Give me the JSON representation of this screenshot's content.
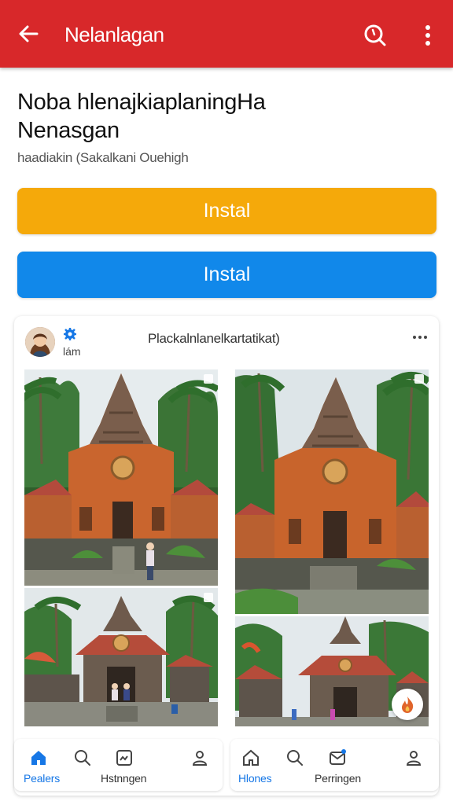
{
  "appbar": {
    "title": "Nelanlagan",
    "icons": [
      "arrow-left-icon",
      "search-icon",
      "more-vert-icon"
    ],
    "color": "#d8282a"
  },
  "headline": {
    "line1": "Noba hlenajkiaplaningHa",
    "line2": "Nenasgan"
  },
  "subline": "haadiakin (Sakalkani Ouehigh",
  "buttons": [
    {
      "label": "Instal",
      "color": "#f5a90a"
    },
    {
      "label": "Instal",
      "color": "#1188ea"
    }
  ],
  "post": {
    "author_meta": "lám",
    "title": "Plackalnlanelkartatikat)",
    "photos": [
      "temple-photo",
      "temple-photo",
      "temple-photo",
      "temple-photo"
    ]
  },
  "bottom_nav_left": [
    {
      "label": "Pealers",
      "icon": "home-icon",
      "active": true
    },
    {
      "label": "",
      "icon": "search-icon"
    },
    {
      "label": "Hstnngen",
      "icon": "image-icon"
    },
    {
      "label": "",
      "icon": "person-icon"
    }
  ],
  "bottom_nav_right": [
    {
      "label": "Hlones",
      "icon": "home-icon",
      "active": true
    },
    {
      "label": "",
      "icon": "search-icon"
    },
    {
      "label": "Perringen",
      "icon": "mail-icon"
    },
    {
      "label": "",
      "icon": "person-icon"
    }
  ]
}
